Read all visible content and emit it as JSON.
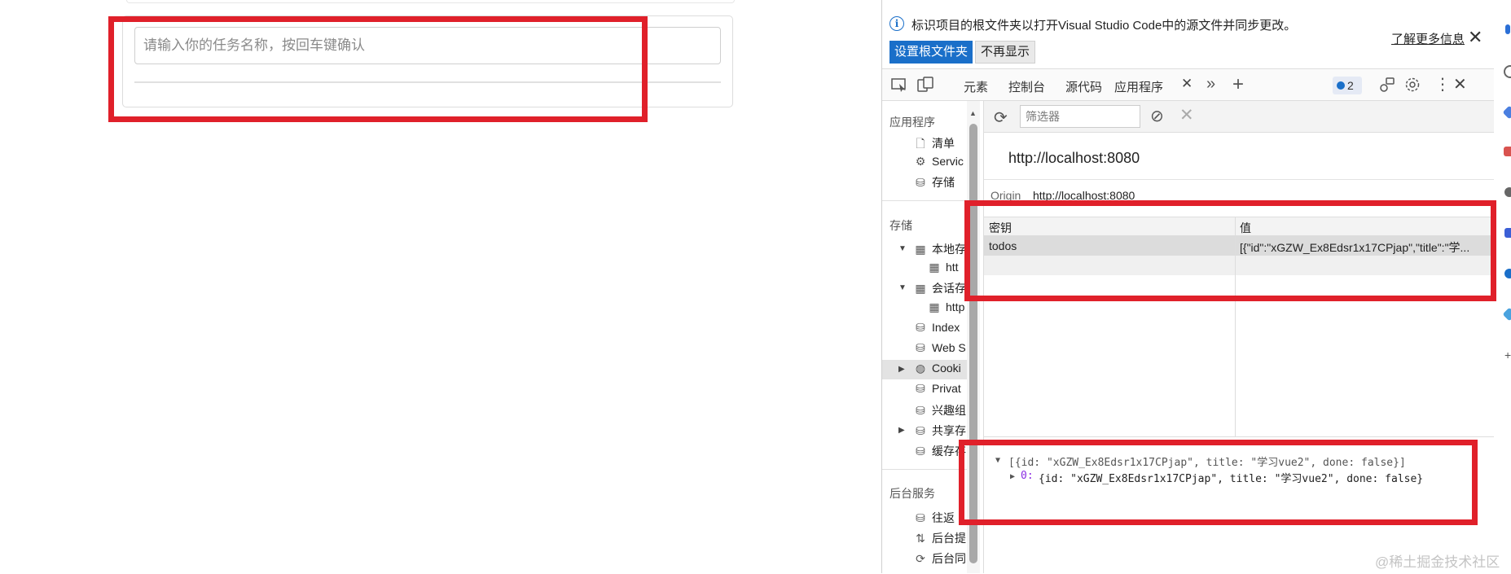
{
  "page": {
    "input_placeholder": "请输入你的任务名称，按回车键确认"
  },
  "devtools": {
    "infobar": {
      "text": "标识项目的根文件夹以打开Visual Studio Code中的源文件并同步更改。",
      "set_root_button": "设置根文件夹",
      "dont_show_button": "不再显示",
      "learn_more": "了解更多信息"
    },
    "tabs": [
      "元素",
      "控制台",
      "源代码",
      "应用程序"
    ],
    "active_tab": "应用程序",
    "issues_count": "2",
    "sidebar": {
      "section_app": "应用程序",
      "app_items": [
        "清单",
        "Servic",
        "存储"
      ],
      "section_storage": "存储",
      "storage_items": {
        "local_storage": "本地存",
        "local_storage_child": "htt",
        "session_storage": "会话存",
        "session_storage_child": "http",
        "indexeddb": "Index",
        "websql": "Web S",
        "cookies": "Cooki",
        "private": "Privat",
        "interest": "兴趣组",
        "shared": "共享存",
        "cache": "缓存存"
      },
      "section_background": "后台服务",
      "background_items": [
        "往返",
        "后台提",
        "后台同"
      ]
    },
    "toolbar": {
      "filter_placeholder": "筛选器"
    },
    "origin_title": "http://localhost:8080",
    "origin_label": "Origin",
    "origin_value": "http://localhost:8080",
    "table": {
      "headers": [
        "密钥",
        "值"
      ],
      "rows": [
        {
          "key": "todos",
          "value": "[{\"id\":\"xGZW_Ex8Edsr1x17CPjap\",\"title\":\"学..."
        }
      ]
    },
    "preview": {
      "summary": "[{id: \"xGZW_Ex8Edsr1x17CPjap\", title: \"学习vue2\", done: false}]",
      "item_index": "0:",
      "item_text": "{id: \"xGZW_Ex8Edsr1x17CPjap\", title: \"学习vue2\", done: false}"
    }
  },
  "watermark": "@稀土掘金技术社区",
  "colors": {
    "highlight_box": "#e0202a",
    "accent": "#1a6fc9"
  }
}
